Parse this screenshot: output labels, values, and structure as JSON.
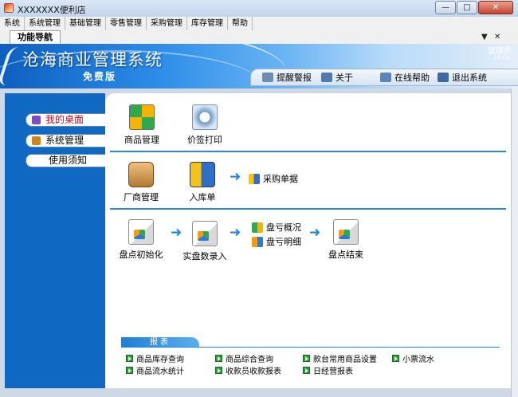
{
  "window": {
    "title": "XXXXXXX便利店",
    "buttons": {
      "minimize": "—",
      "maximize": "□",
      "close": "✕"
    }
  },
  "menu": [
    "系统",
    "系统管理",
    "基础管理",
    "零售管理",
    "采购管理",
    "库存管理",
    "帮助"
  ],
  "tab": {
    "label": "功能导航",
    "dropdown": "▼",
    "close": "✕"
  },
  "banner": {
    "title": "沧海商业管理系统",
    "subtitle": "免费版",
    "user_name": "管理员",
    "user_code": "zzcs"
  },
  "topnav": [
    {
      "label": "提醒警报",
      "icon": "alarm-clock-icon",
      "color": "#6c8db5"
    },
    {
      "label": "关于",
      "icon": "about-icon",
      "color": "#4f79b0"
    },
    {
      "label": "在线帮助",
      "icon": "help-icon",
      "color": "#5a86bc"
    },
    {
      "label": "退出系统",
      "icon": "exit-icon",
      "color": "#3d6aa6"
    }
  ],
  "sidebar": [
    {
      "label": "我的桌面",
      "icon": "desktop-icon",
      "color": "#7a4fc2",
      "active": true
    },
    {
      "label": "系统管理",
      "icon": "system-icon",
      "color": "#c9851e",
      "active": false
    },
    {
      "label": "使用须知",
      "icon": "",
      "color": "",
      "active": false
    }
  ],
  "main": {
    "row1": [
      {
        "label": "商品管理",
        "icon": "goods-icon"
      },
      {
        "label": "价签打印",
        "icon": "price-tag-print-icon"
      }
    ],
    "row2": [
      {
        "label": "厂商管理",
        "icon": "vendor-icon"
      },
      {
        "label": "入库单",
        "icon": "stock-in-truck-icon"
      }
    ],
    "row2_link": "采购单据",
    "row3": [
      {
        "label": "盘点初始化",
        "icon": "inventory-init-icon"
      },
      {
        "label": "实盘数录入",
        "icon": "actual-count-icon"
      },
      {
        "label": "盘点结束",
        "icon": "inventory-end-icon"
      }
    ],
    "row3_links": [
      "盘亏概况",
      "盘亏明细"
    ],
    "arrow": "➜"
  },
  "reports": {
    "title": "报表",
    "items": [
      "商品库存查询",
      "商品综合查询",
      "款台常用商品设置",
      "小票流水",
      "商品流水统计",
      "收款员收款报表",
      "日经营报表"
    ]
  }
}
